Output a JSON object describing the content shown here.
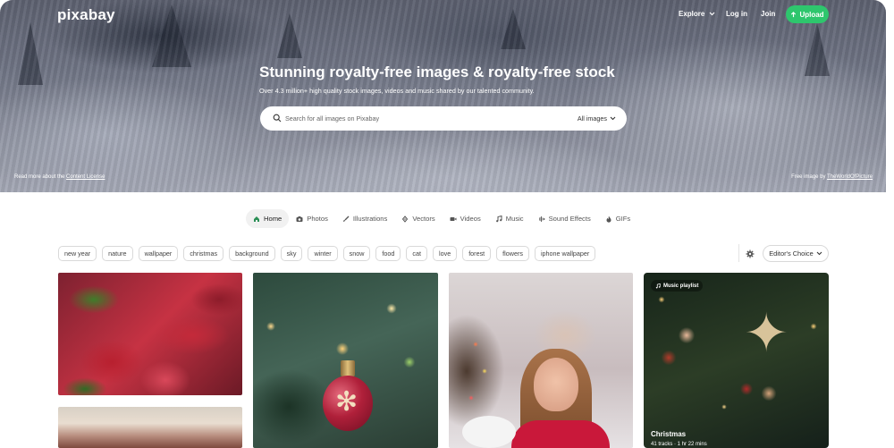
{
  "header": {
    "logo": "pixabay",
    "explore": "Explore",
    "login": "Log in",
    "join": "Join",
    "upload": "Upload"
  },
  "hero": {
    "title": "Stunning royalty-free images & royalty-free stock",
    "subtitle": "Over 4.3 million+ high quality stock images, videos and music shared by our talented community.",
    "search_placeholder": "Search for all images on Pixabay",
    "search_type": "All images",
    "license_prefix": "Read more about the ",
    "license_link": "Content License",
    "credit_prefix": "Free image by ",
    "credit_link": "TheWorldOfPicture"
  },
  "tabs": [
    {
      "label": "Home",
      "icon": "home-icon"
    },
    {
      "label": "Photos",
      "icon": "camera-icon"
    },
    {
      "label": "Illustrations",
      "icon": "brush-icon"
    },
    {
      "label": "Vectors",
      "icon": "pen-icon"
    },
    {
      "label": "Videos",
      "icon": "video-icon"
    },
    {
      "label": "Music",
      "icon": "music-icon"
    },
    {
      "label": "Sound Effects",
      "icon": "waveform-icon"
    },
    {
      "label": "GIFs",
      "icon": "flame-icon"
    }
  ],
  "tags": [
    "new year",
    "nature",
    "wallpaper",
    "christmas",
    "background",
    "sky",
    "winter",
    "snow",
    "food",
    "cat",
    "love",
    "forest",
    "flowers",
    "iphone wallpaper"
  ],
  "sort": "Editor's Choice",
  "cards": {
    "music": {
      "badge": "Music playlist",
      "title": "Christmas",
      "meta": "41 tracks · 1 hr 22 mins"
    }
  },
  "colors": {
    "accent": "#2ec66d",
    "active_tab_bg": "#f1f1f1"
  }
}
